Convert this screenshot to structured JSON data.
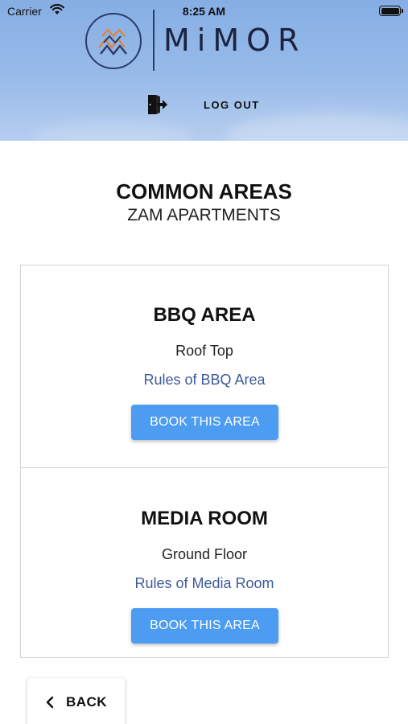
{
  "status_bar": {
    "carrier": "Carrier",
    "time": "8:25 AM",
    "battery_level": 1.0
  },
  "header": {
    "logo_text": "MiMOR",
    "logout_label": "LOG OUT",
    "logout_icon": "logout-icon"
  },
  "page": {
    "title": "COMMON AREAS",
    "subtitle": "ZAM APARTMENTS"
  },
  "areas": [
    {
      "name": "BBQ AREA",
      "location": "Roof Top",
      "rules_link": "Rules of BBQ Area",
      "book_label": "BOOK THIS AREA"
    },
    {
      "name": "MEDIA ROOM",
      "location": "Ground Floor",
      "rules_link": "Rules of Media Room",
      "book_label": "BOOK THIS AREA"
    }
  ],
  "footer": {
    "back_label": "BACK",
    "back_icon": "chevron-left-icon"
  },
  "colors": {
    "primary_button": "#4c9cf2",
    "link": "#3d5a9a",
    "header_sky": "#8fb4e6",
    "logo_navy": "#1b2340",
    "logo_orange": "#e0823a"
  }
}
